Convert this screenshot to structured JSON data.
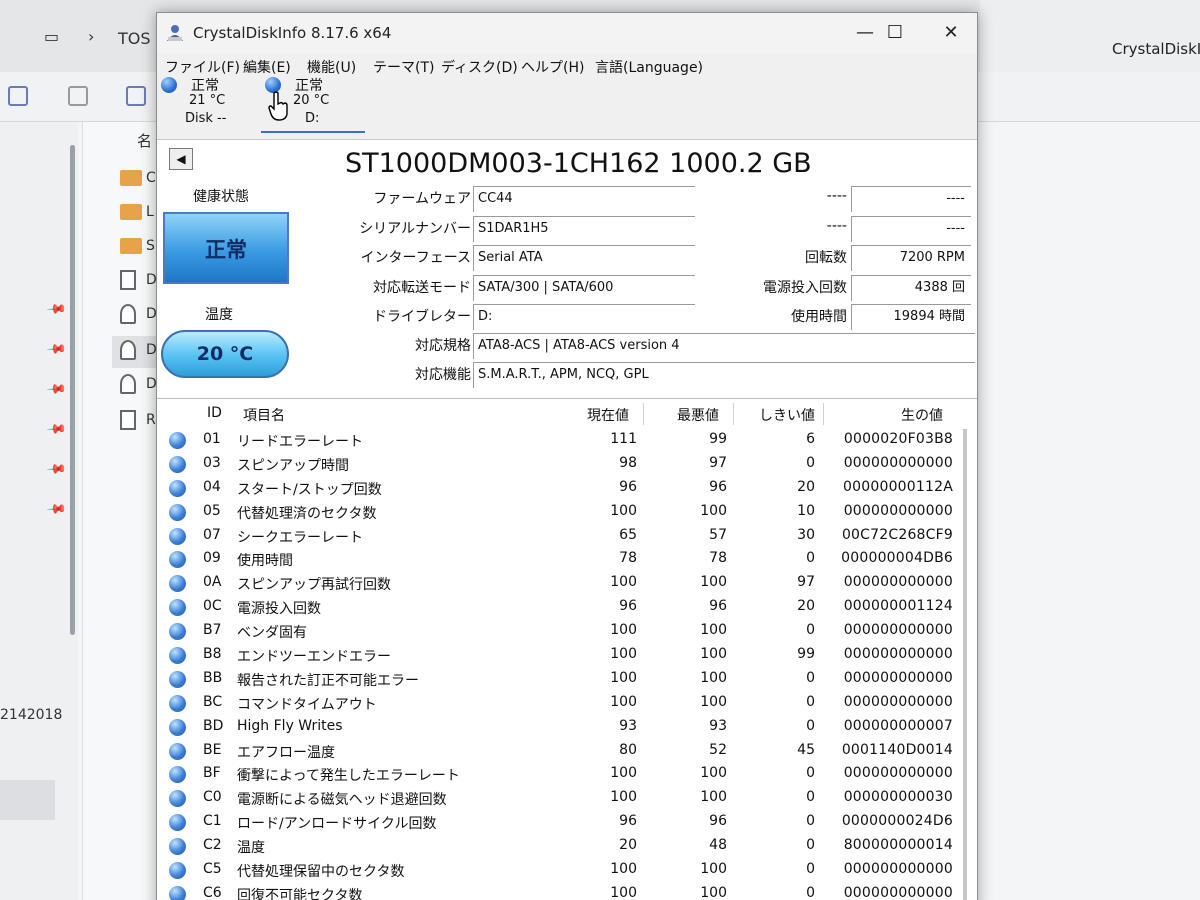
{
  "background": {
    "nav_label": "TOS",
    "right_title": "CrystalDiskIn",
    "column_header": "名",
    "list_letters": [
      "C",
      "L",
      "S",
      "D",
      "D",
      "D",
      "D",
      "R"
    ],
    "bottom_label": "2142018"
  },
  "app": {
    "title": "CrystalDiskInfo 8.17.6 x64",
    "menu": [
      "ファイル(F)",
      "編集(E)",
      "機能(U)",
      "テーマ(T)",
      "ディスク(D)",
      "ヘルプ(H)",
      "言語(Language)"
    ]
  },
  "drives": [
    {
      "status": "正常",
      "temp": "21 °C",
      "letter": "Disk --"
    },
    {
      "status": "正常",
      "temp": "20 °C",
      "letter": "D:"
    }
  ],
  "disk": {
    "model": "ST1000DM003-1CH162 1000.2 GB",
    "health_label": "健康状態",
    "health_value": "正常",
    "temp_label": "温度",
    "temp_value": "20 °C",
    "firmware_label": "ファームウェア",
    "firmware": "CC44",
    "serial_label": "シリアルナンバー",
    "serial": "S1DAR1H5",
    "interface_label": "インターフェース",
    "interface": "Serial ATA",
    "transfer_label": "対応転送モード",
    "transfer": "SATA/300 | SATA/600",
    "drive_letter_label": "ドライブレター",
    "drive_letter": "D:",
    "standard_label": "対応規格",
    "standard": "ATA8-ACS | ATA8-ACS version 4",
    "features_label": "対応機能",
    "features": "S.M.A.R.T., APM, NCQ, GPL",
    "right_blank1_label": "----",
    "right_blank1": "----",
    "right_blank2_label": "----",
    "right_blank2": "----",
    "rotation_label": "回転数",
    "rotation": "7200 RPM",
    "power_count_label": "電源投入回数",
    "power_count": "4388 回",
    "power_hours_label": "使用時間",
    "power_hours": "19894 時間"
  },
  "smart": {
    "headers": {
      "id": "ID",
      "name": "項目名",
      "current": "現在値",
      "worst": "最悪値",
      "threshold": "しきい値",
      "raw": "生の値"
    },
    "rows": [
      {
        "id": "01",
        "name": "リードエラーレート",
        "current": "111",
        "worst": "99",
        "threshold": "6",
        "raw": "0000020F03B8"
      },
      {
        "id": "03",
        "name": "スピンアップ時間",
        "current": "98",
        "worst": "97",
        "threshold": "0",
        "raw": "000000000000"
      },
      {
        "id": "04",
        "name": "スタート/ストップ回数",
        "current": "96",
        "worst": "96",
        "threshold": "20",
        "raw": "00000000112A"
      },
      {
        "id": "05",
        "name": "代替処理済のセクタ数",
        "current": "100",
        "worst": "100",
        "threshold": "10",
        "raw": "000000000000"
      },
      {
        "id": "07",
        "name": "シークエラーレート",
        "current": "65",
        "worst": "57",
        "threshold": "30",
        "raw": "00C72C268CF9"
      },
      {
        "id": "09",
        "name": "使用時間",
        "current": "78",
        "worst": "78",
        "threshold": "0",
        "raw": "000000004DB6"
      },
      {
        "id": "0A",
        "name": "スピンアップ再試行回数",
        "current": "100",
        "worst": "100",
        "threshold": "97",
        "raw": "000000000000"
      },
      {
        "id": "0C",
        "name": "電源投入回数",
        "current": "96",
        "worst": "96",
        "threshold": "20",
        "raw": "000000001124"
      },
      {
        "id": "B7",
        "name": "ベンダ固有",
        "current": "100",
        "worst": "100",
        "threshold": "0",
        "raw": "000000000000"
      },
      {
        "id": "B8",
        "name": "エンドツーエンドエラー",
        "current": "100",
        "worst": "100",
        "threshold": "99",
        "raw": "000000000000"
      },
      {
        "id": "BB",
        "name": "報告された訂正不可能エラー",
        "current": "100",
        "worst": "100",
        "threshold": "0",
        "raw": "000000000000"
      },
      {
        "id": "BC",
        "name": "コマンドタイムアウト",
        "current": "100",
        "worst": "100",
        "threshold": "0",
        "raw": "000000000000"
      },
      {
        "id": "BD",
        "name": "High Fly Writes",
        "current": "93",
        "worst": "93",
        "threshold": "0",
        "raw": "000000000007"
      },
      {
        "id": "BE",
        "name": "エアフロー温度",
        "current": "80",
        "worst": "52",
        "threshold": "45",
        "raw": "0001140D0014"
      },
      {
        "id": "BF",
        "name": "衝撃によって発生したエラーレート",
        "current": "100",
        "worst": "100",
        "threshold": "0",
        "raw": "000000000000"
      },
      {
        "id": "C0",
        "name": "電源断による磁気ヘッド退避回数",
        "current": "100",
        "worst": "100",
        "threshold": "0",
        "raw": "000000000030"
      },
      {
        "id": "C1",
        "name": "ロード/アンロードサイクル回数",
        "current": "96",
        "worst": "96",
        "threshold": "0",
        "raw": "0000000024D6"
      },
      {
        "id": "C2",
        "name": "温度",
        "current": "20",
        "worst": "48",
        "threshold": "0",
        "raw": "800000000014"
      },
      {
        "id": "C5",
        "name": "代替処理保留中のセクタ数",
        "current": "100",
        "worst": "100",
        "threshold": "0",
        "raw": "000000000000"
      },
      {
        "id": "C6",
        "name": "回復不可能セクタ数",
        "current": "100",
        "worst": "100",
        "threshold": "0",
        "raw": "000000000000"
      }
    ]
  }
}
